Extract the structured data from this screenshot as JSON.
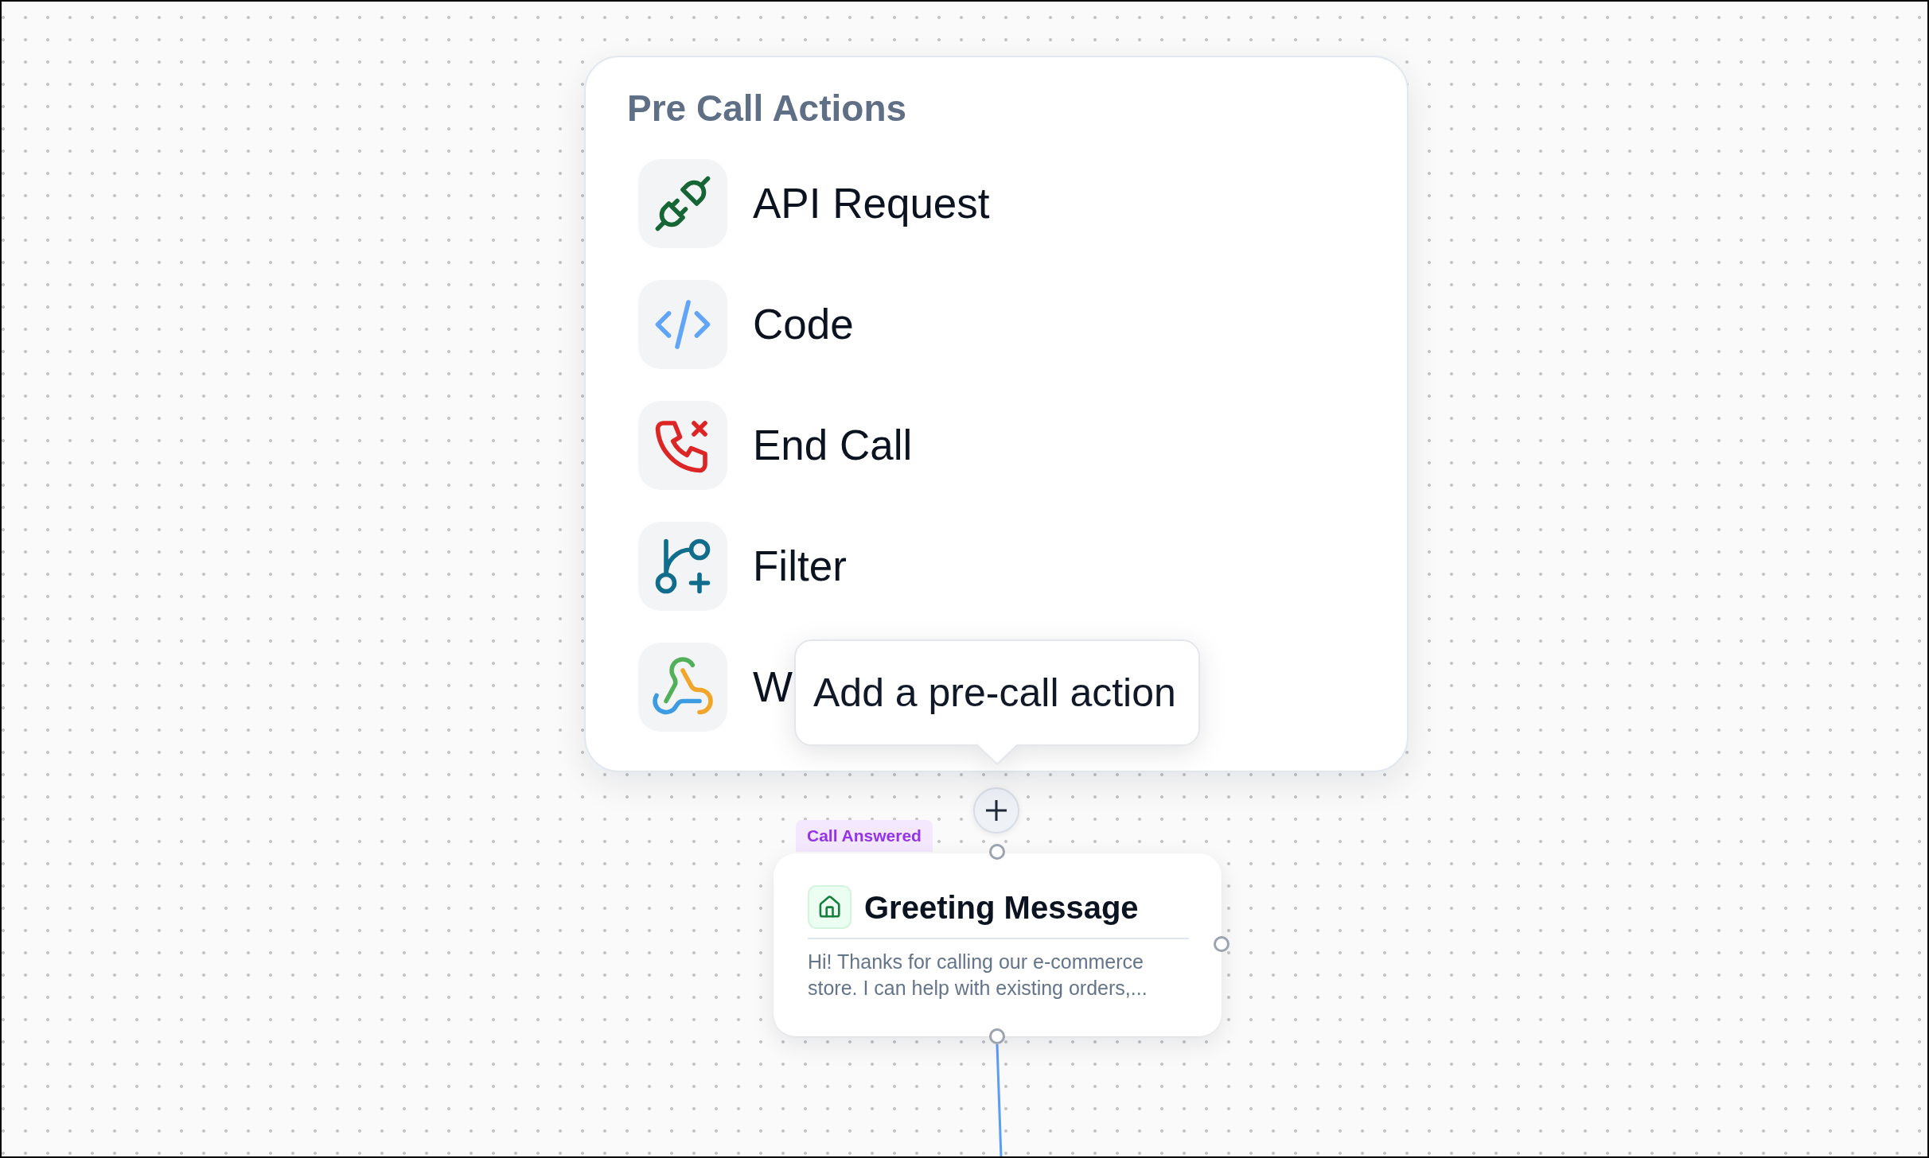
{
  "menu": {
    "title": "Pre Call Actions",
    "items": [
      {
        "kind": "api_request",
        "label": "API Request"
      },
      {
        "kind": "code",
        "label": "Code"
      },
      {
        "kind": "end_call",
        "label": "End Call"
      },
      {
        "kind": "filter",
        "label": "Filter"
      },
      {
        "kind": "webhook",
        "label": "W"
      }
    ]
  },
  "tooltip": {
    "text": "Add a pre-call action"
  },
  "node": {
    "tag": "Call Answered",
    "title": "Greeting Message",
    "description": "Hi! Thanks for calling our e-commerce store. I can help with existing orders,..."
  }
}
